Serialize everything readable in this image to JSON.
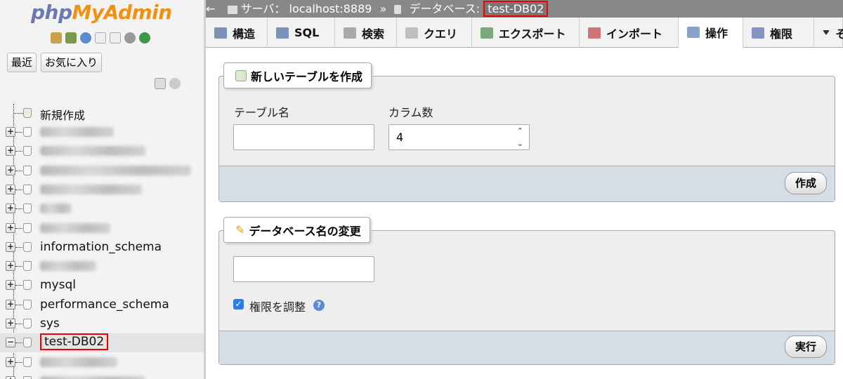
{
  "logo": {
    "part1": "php",
    "part2": "MyAdmin"
  },
  "sidebar": {
    "recent_btn": "最近",
    "fav_btn": "お気に入り",
    "new_label": "新規作成",
    "databases": [
      {
        "name": "",
        "blurred": true
      },
      {
        "name": "",
        "blurred": true
      },
      {
        "name": "",
        "blurred": true
      },
      {
        "name": "",
        "blurred": true
      },
      {
        "name": "",
        "blurred": true
      },
      {
        "name": "",
        "blurred": true
      },
      {
        "name": "information_schema",
        "blurred": false
      },
      {
        "name": "",
        "blurred": true
      },
      {
        "name": "mysql",
        "blurred": false
      },
      {
        "name": "performance_schema",
        "blurred": false
      },
      {
        "name": "sys",
        "blurred": false
      },
      {
        "name": "test-DB02",
        "blurred": false,
        "selected": true
      },
      {
        "name": "",
        "blurred": true
      },
      {
        "name": "",
        "blurred": true
      }
    ]
  },
  "breadcrumb": {
    "arrow": "←",
    "server_label": "サーバ：",
    "server": "localhost:8889",
    "sep": "»",
    "db_label": "データベース:",
    "db": "test-DB02"
  },
  "tabs": [
    {
      "label": "構造",
      "icon": "structure-icon"
    },
    {
      "label": "SQL",
      "icon": "sql-icon"
    },
    {
      "label": "検索",
      "icon": "search-icon"
    },
    {
      "label": "クエリ",
      "icon": "query-icon"
    },
    {
      "label": "エクスポート",
      "icon": "export-icon"
    },
    {
      "label": "インポート",
      "icon": "import-icon"
    },
    {
      "label": "操作",
      "icon": "wrench-icon",
      "active": true
    },
    {
      "label": "権限",
      "icon": "privileges-icon"
    },
    {
      "label": "そ",
      "icon": "more-icon"
    }
  ],
  "create_table": {
    "legend": "新しいテーブルを作成",
    "name_label": "テーブル名",
    "name_value": "",
    "cols_label": "カラム数",
    "cols_value": "4",
    "submit": "作成"
  },
  "rename_db": {
    "legend": "データベース名の変更",
    "name_value": "",
    "checkbox_label": "権限を調整",
    "checked": true,
    "submit": "実行"
  },
  "colors": {
    "accent": "#6c78af",
    "logo_orange": "#f29111",
    "footer_bg": "#d5dde7",
    "highlight": "#e00000"
  }
}
